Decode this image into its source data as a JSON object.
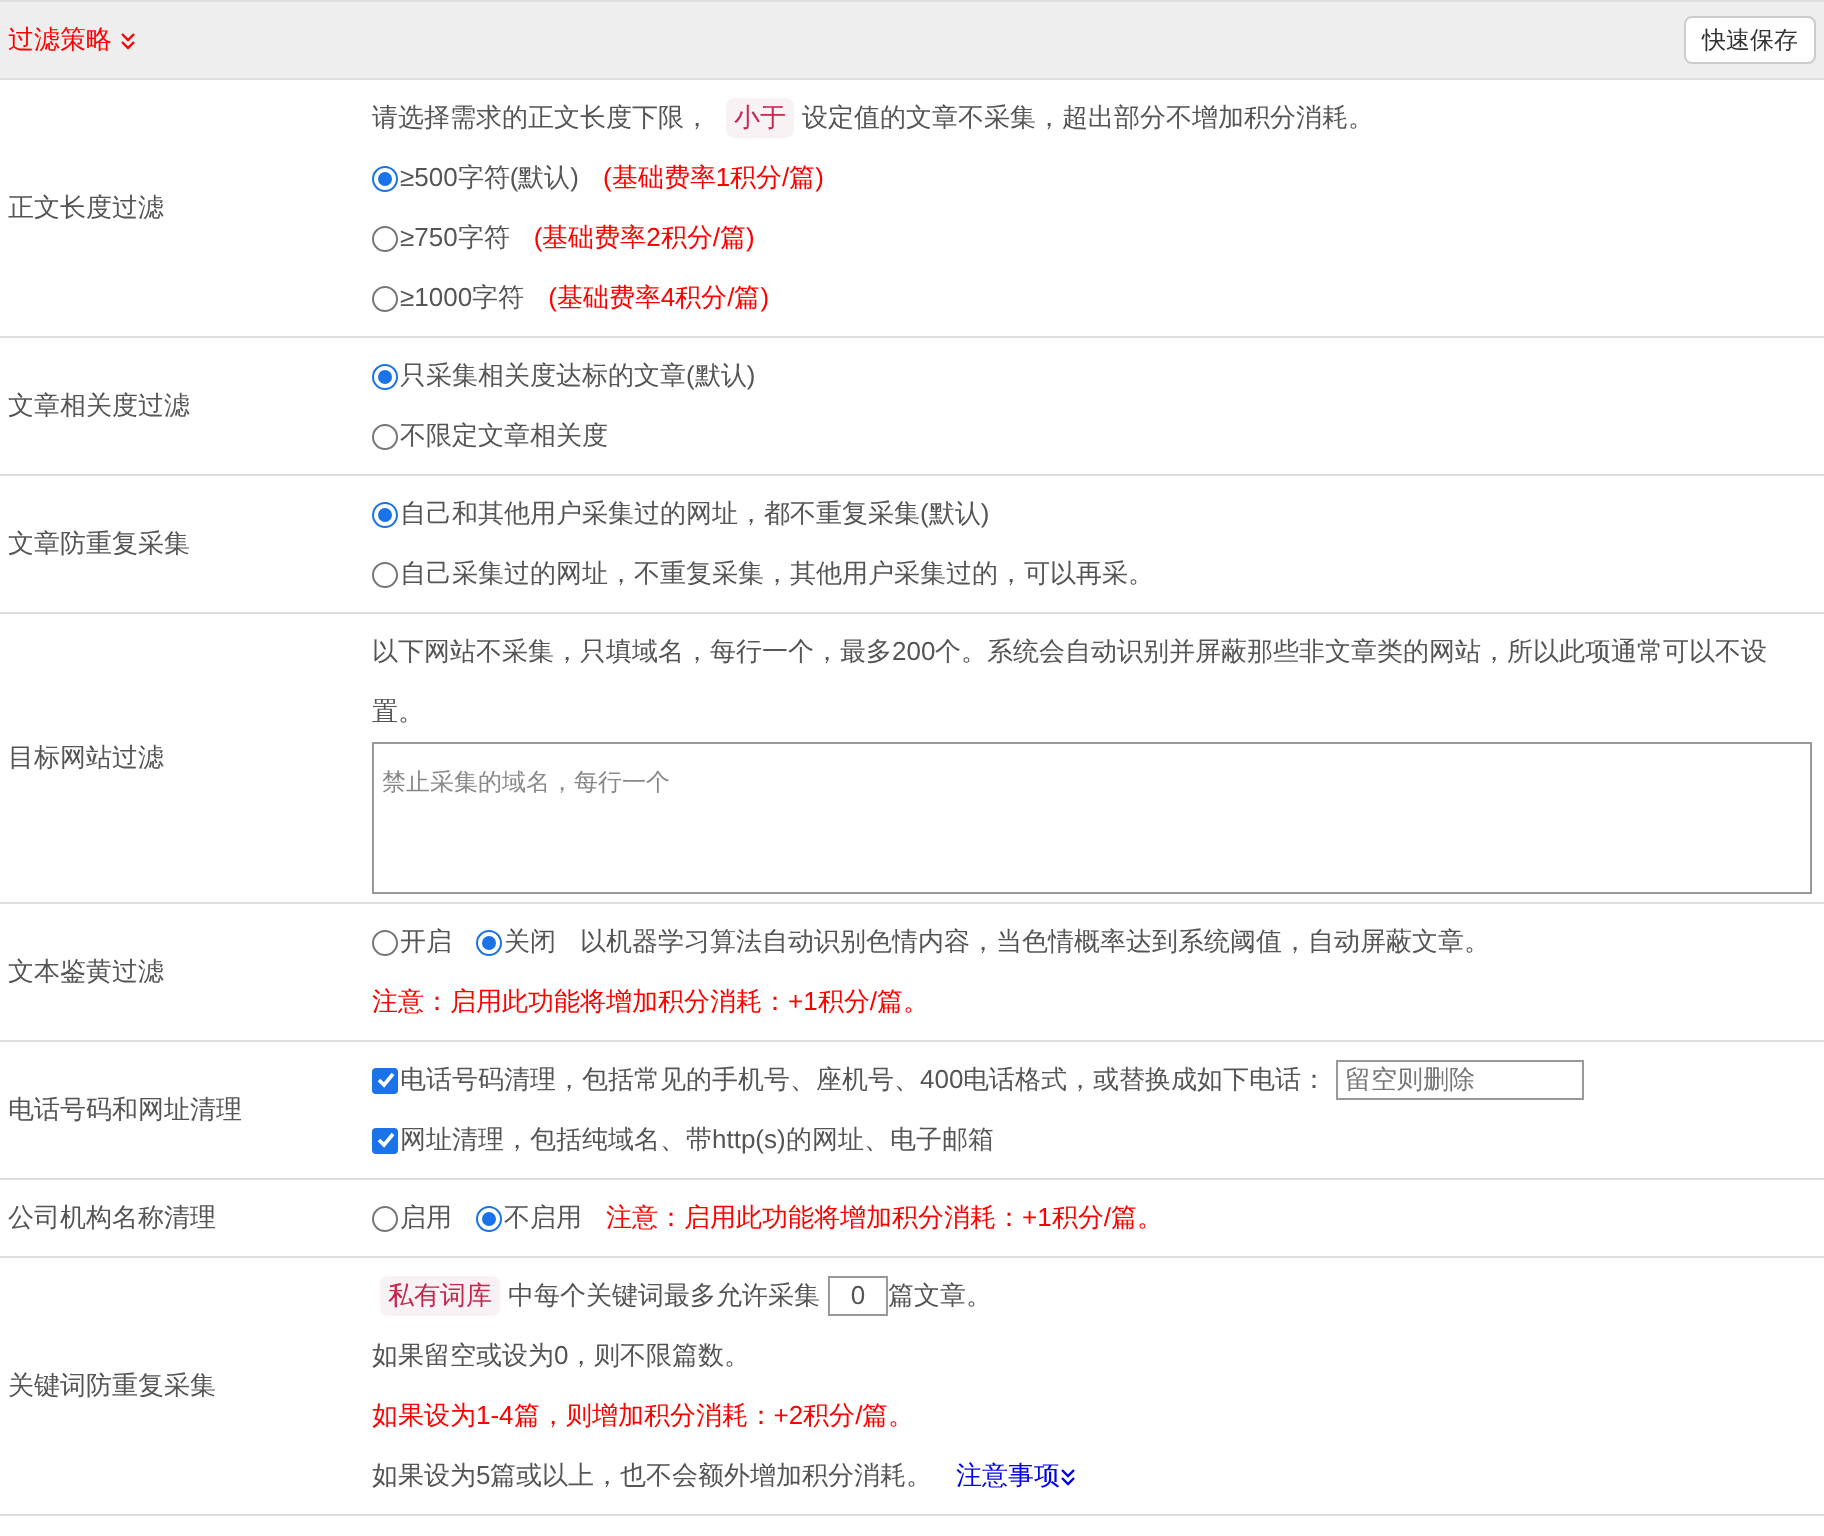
{
  "header": {
    "title": "过滤策略",
    "save_button": "快速保存"
  },
  "rows": [
    {
      "label": "正文长度过滤",
      "lines": [
        [
          {
            "kind": "text",
            "text": "请选择需求的正文长度下限，"
          },
          {
            "kind": "tag",
            "text": "小于"
          },
          {
            "kind": "text",
            "text": "设定值的文章不采集，超出部分不增加积分消耗。"
          }
        ],
        [
          {
            "kind": "radio",
            "label": "≥500字符(默认)",
            "selected": true
          },
          {
            "kind": "note",
            "text": "(基础费率1积分/篇)"
          }
        ],
        [
          {
            "kind": "radio",
            "label": "≥750字符",
            "selected": false
          },
          {
            "kind": "note",
            "text": "(基础费率2积分/篇)"
          }
        ],
        [
          {
            "kind": "radio",
            "label": "≥1000字符",
            "selected": false
          },
          {
            "kind": "note",
            "text": "(基础费率4积分/篇)"
          }
        ]
      ]
    },
    {
      "label": "文章相关度过滤",
      "lines": [
        [
          {
            "kind": "radio",
            "label": "只采集相关度达标的文章(默认)",
            "selected": true
          }
        ],
        [
          {
            "kind": "radio",
            "label": "不限定文章相关度",
            "selected": false
          }
        ]
      ]
    },
    {
      "label": "文章防重复采集",
      "lines": [
        [
          {
            "kind": "radio",
            "label": "自己和其他用户采集过的网址，都不重复采集(默认)",
            "selected": true
          }
        ],
        [
          {
            "kind": "radio",
            "label": "自己采集过的网址，不重复采集，其他用户采集过的，可以再采。",
            "selected": false
          }
        ]
      ]
    },
    {
      "label": "目标网站过滤",
      "lines": [
        [
          {
            "kind": "text",
            "text": "以下网站不采集，只填域名，每行一个，最多200个。系统会自动识别并屏蔽那些非文章类的网站，所以此项通常可以不设置。"
          }
        ],
        [
          {
            "kind": "textarea",
            "placeholder": "禁止采集的域名，每行一个"
          }
        ]
      ]
    },
    {
      "label": "文本鉴黄过滤",
      "lines": [
        [
          {
            "kind": "radio",
            "label": "开启",
            "selected": false
          },
          {
            "kind": "radio",
            "label": "关闭",
            "selected": true
          },
          {
            "kind": "text",
            "text": "以机器学习算法自动识别色情内容，当色情概率达到系统阈值，自动屏蔽文章。"
          }
        ],
        [
          {
            "kind": "note",
            "text": "注意：启用此功能将增加积分消耗：+1积分/篇。"
          }
        ]
      ]
    },
    {
      "label": "电话号码和网址清理",
      "lines": [
        [
          {
            "kind": "checkbox",
            "label": "电话号码清理，包括常见的手机号、座机号、400电话格式，或替换成如下电话：",
            "checked": true
          },
          {
            "kind": "input",
            "placeholder": "留空则删除"
          }
        ],
        [
          {
            "kind": "checkbox",
            "label": "网址清理，包括纯域名、带http(s)的网址、电子邮箱",
            "checked": true
          }
        ]
      ]
    },
    {
      "label": "公司机构名称清理",
      "lines": [
        [
          {
            "kind": "radio",
            "label": "启用",
            "selected": false
          },
          {
            "kind": "radio",
            "label": "不启用",
            "selected": true
          },
          {
            "kind": "note",
            "text": "注意：启用此功能将增加积分消耗：+1积分/篇。"
          }
        ]
      ]
    },
    {
      "label": "关键词防重复采集",
      "lines": [
        [
          {
            "kind": "tag",
            "text": "私有词库"
          },
          {
            "kind": "text",
            "text": "中每个关键词最多允许采集"
          },
          {
            "kind": "number",
            "value": "0"
          },
          {
            "kind": "text",
            "text": "篇文章。"
          }
        ],
        [
          {
            "kind": "text",
            "text": "如果留空或设为0，则不限篇数。"
          }
        ],
        [
          {
            "kind": "note",
            "text": "如果设为1-4篇，则增加积分消耗：+2积分/篇。"
          }
        ],
        [
          {
            "kind": "text",
            "text": "如果设为5篇或以上，也不会额外增加积分消耗。"
          },
          {
            "kind": "link",
            "text": "注意事项"
          }
        ]
      ]
    }
  ]
}
